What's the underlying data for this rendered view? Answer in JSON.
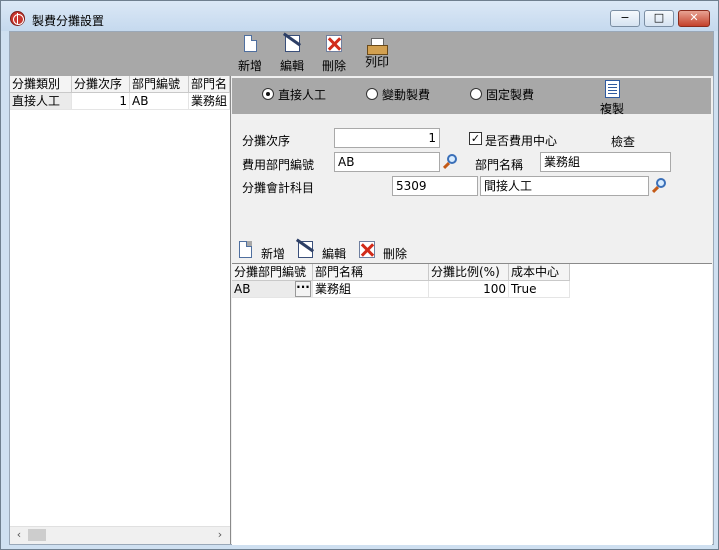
{
  "window": {
    "title": "製費分攤設置",
    "controls": {
      "minimize": "−",
      "maximize": "□",
      "close": "✕"
    }
  },
  "toolbar": {
    "buttons": [
      {
        "label": "新增",
        "icon": "new-document-icon"
      },
      {
        "label": "編輯",
        "icon": "edit-icon"
      },
      {
        "label": "刪除",
        "icon": "delete-icon"
      },
      {
        "label": "列印",
        "icon": "printer-icon"
      }
    ]
  },
  "left_grid": {
    "columns": [
      "分攤類別",
      "分攤次序",
      "部門編號",
      "部門名"
    ],
    "rows": [
      {
        "category": "直接人工",
        "order": "1",
        "dept_code": "AB",
        "dept_name": "業務組"
      }
    ],
    "scroll": {
      "left": "‹",
      "right": "›"
    }
  },
  "cost_type": {
    "options": [
      "直接人工",
      "變動製費",
      "固定製費"
    ],
    "selected": "直接人工",
    "copy_label": "複製",
    "copy_icon": "copy-list-icon"
  },
  "form": {
    "order_label": "分攤次序",
    "order_value": "1",
    "cost_center_label": "是否費用中心",
    "cost_center_checked": true,
    "check_mark": "✓",
    "check_button": "檢查",
    "dept_code_label": "費用部門編號",
    "dept_code_value": "AB",
    "dept_name_label": "部門名稱",
    "dept_name_value": "業務組",
    "account_label": "分攤會計科目",
    "account_code": "5309",
    "account_name": "間接人工"
  },
  "detail_toolbar": {
    "buttons": [
      {
        "label": "新增",
        "icon": "new-document-icon"
      },
      {
        "label": "編輯",
        "icon": "edit-icon"
      },
      {
        "label": "刪除",
        "icon": "delete-icon"
      }
    ]
  },
  "detail_grid": {
    "columns": [
      "分攤部門編號",
      "部門名稱",
      "分攤比例(%)",
      "成本中心"
    ],
    "rows": [
      {
        "dept_code": "AB",
        "dept_name": "業務組",
        "ratio": "100",
        "cost_center": "True",
        "lookup": "···"
      }
    ]
  }
}
